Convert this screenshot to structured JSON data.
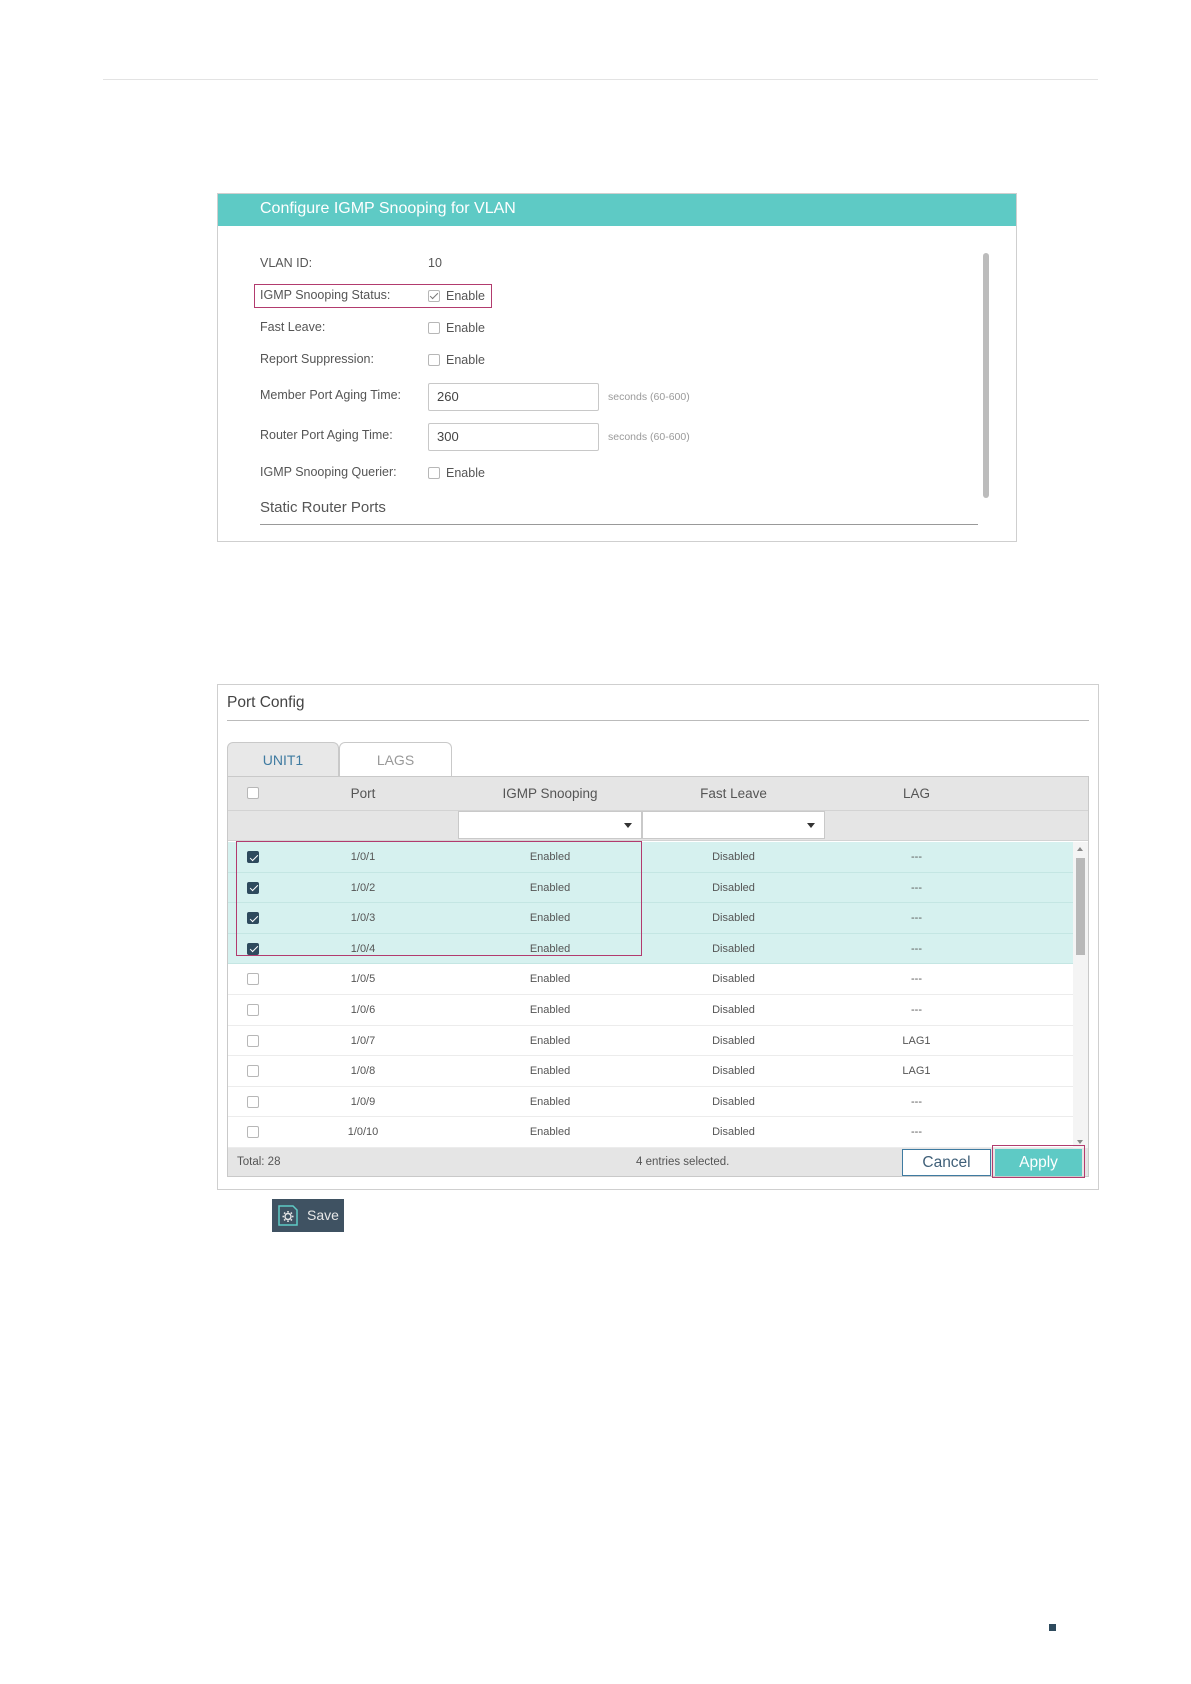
{
  "vlan_panel": {
    "title": "Configure IGMP Snooping for VLAN",
    "vlan_id_label": "VLAN ID:",
    "vlan_id_value": "10",
    "igmp_status_label": "IGMP Snooping Status:",
    "igmp_status_checked": true,
    "fast_leave_label": "Fast Leave:",
    "report_suppression_label": "Report Suppression:",
    "member_aging_label": "Member Port Aging Time:",
    "member_aging_value": "260",
    "router_aging_label": "Router Port Aging Time:",
    "router_aging_value": "300",
    "aging_hint": "seconds (60-600)",
    "querier_label": "IGMP Snooping Querier:",
    "enable_label": "Enable",
    "static_router_ports": "Static Router Ports"
  },
  "port_config": {
    "title": "Port Config",
    "tabs": [
      "UNIT1",
      "LAGS"
    ],
    "active_tab": "UNIT1",
    "columns": [
      "Port",
      "IGMP Snooping",
      "Fast Leave",
      "LAG"
    ],
    "rows": [
      {
        "port": "1/0/1",
        "igmp": "Enabled",
        "fast_leave": "Disabled",
        "lag": "---",
        "checked": true
      },
      {
        "port": "1/0/2",
        "igmp": "Enabled",
        "fast_leave": "Disabled",
        "lag": "---",
        "checked": true
      },
      {
        "port": "1/0/3",
        "igmp": "Enabled",
        "fast_leave": "Disabled",
        "lag": "---",
        "checked": true
      },
      {
        "port": "1/0/4",
        "igmp": "Enabled",
        "fast_leave": "Disabled",
        "lag": "---",
        "checked": true
      },
      {
        "port": "1/0/5",
        "igmp": "Enabled",
        "fast_leave": "Disabled",
        "lag": "---",
        "checked": false
      },
      {
        "port": "1/0/6",
        "igmp": "Enabled",
        "fast_leave": "Disabled",
        "lag": "---",
        "checked": false
      },
      {
        "port": "1/0/7",
        "igmp": "Enabled",
        "fast_leave": "Disabled",
        "lag": "LAG1",
        "checked": false
      },
      {
        "port": "1/0/8",
        "igmp": "Enabled",
        "fast_leave": "Disabled",
        "lag": "LAG1",
        "checked": false
      },
      {
        "port": "1/0/9",
        "igmp": "Enabled",
        "fast_leave": "Disabled",
        "lag": "---",
        "checked": false
      },
      {
        "port": "1/0/10",
        "igmp": "Enabled",
        "fast_leave": "Disabled",
        "lag": "---",
        "checked": false
      }
    ],
    "total": "Total: 28",
    "selected_info": "4 entries selected.",
    "cancel_label": "Cancel",
    "apply_label": "Apply"
  },
  "save_button": {
    "label": "Save",
    "icon": "save-gear-icon"
  },
  "colors": {
    "accent": "#5ecac5",
    "highlight": "#b23b6e",
    "checked_row": "#d6f1ef",
    "dark": "#3f5262"
  }
}
